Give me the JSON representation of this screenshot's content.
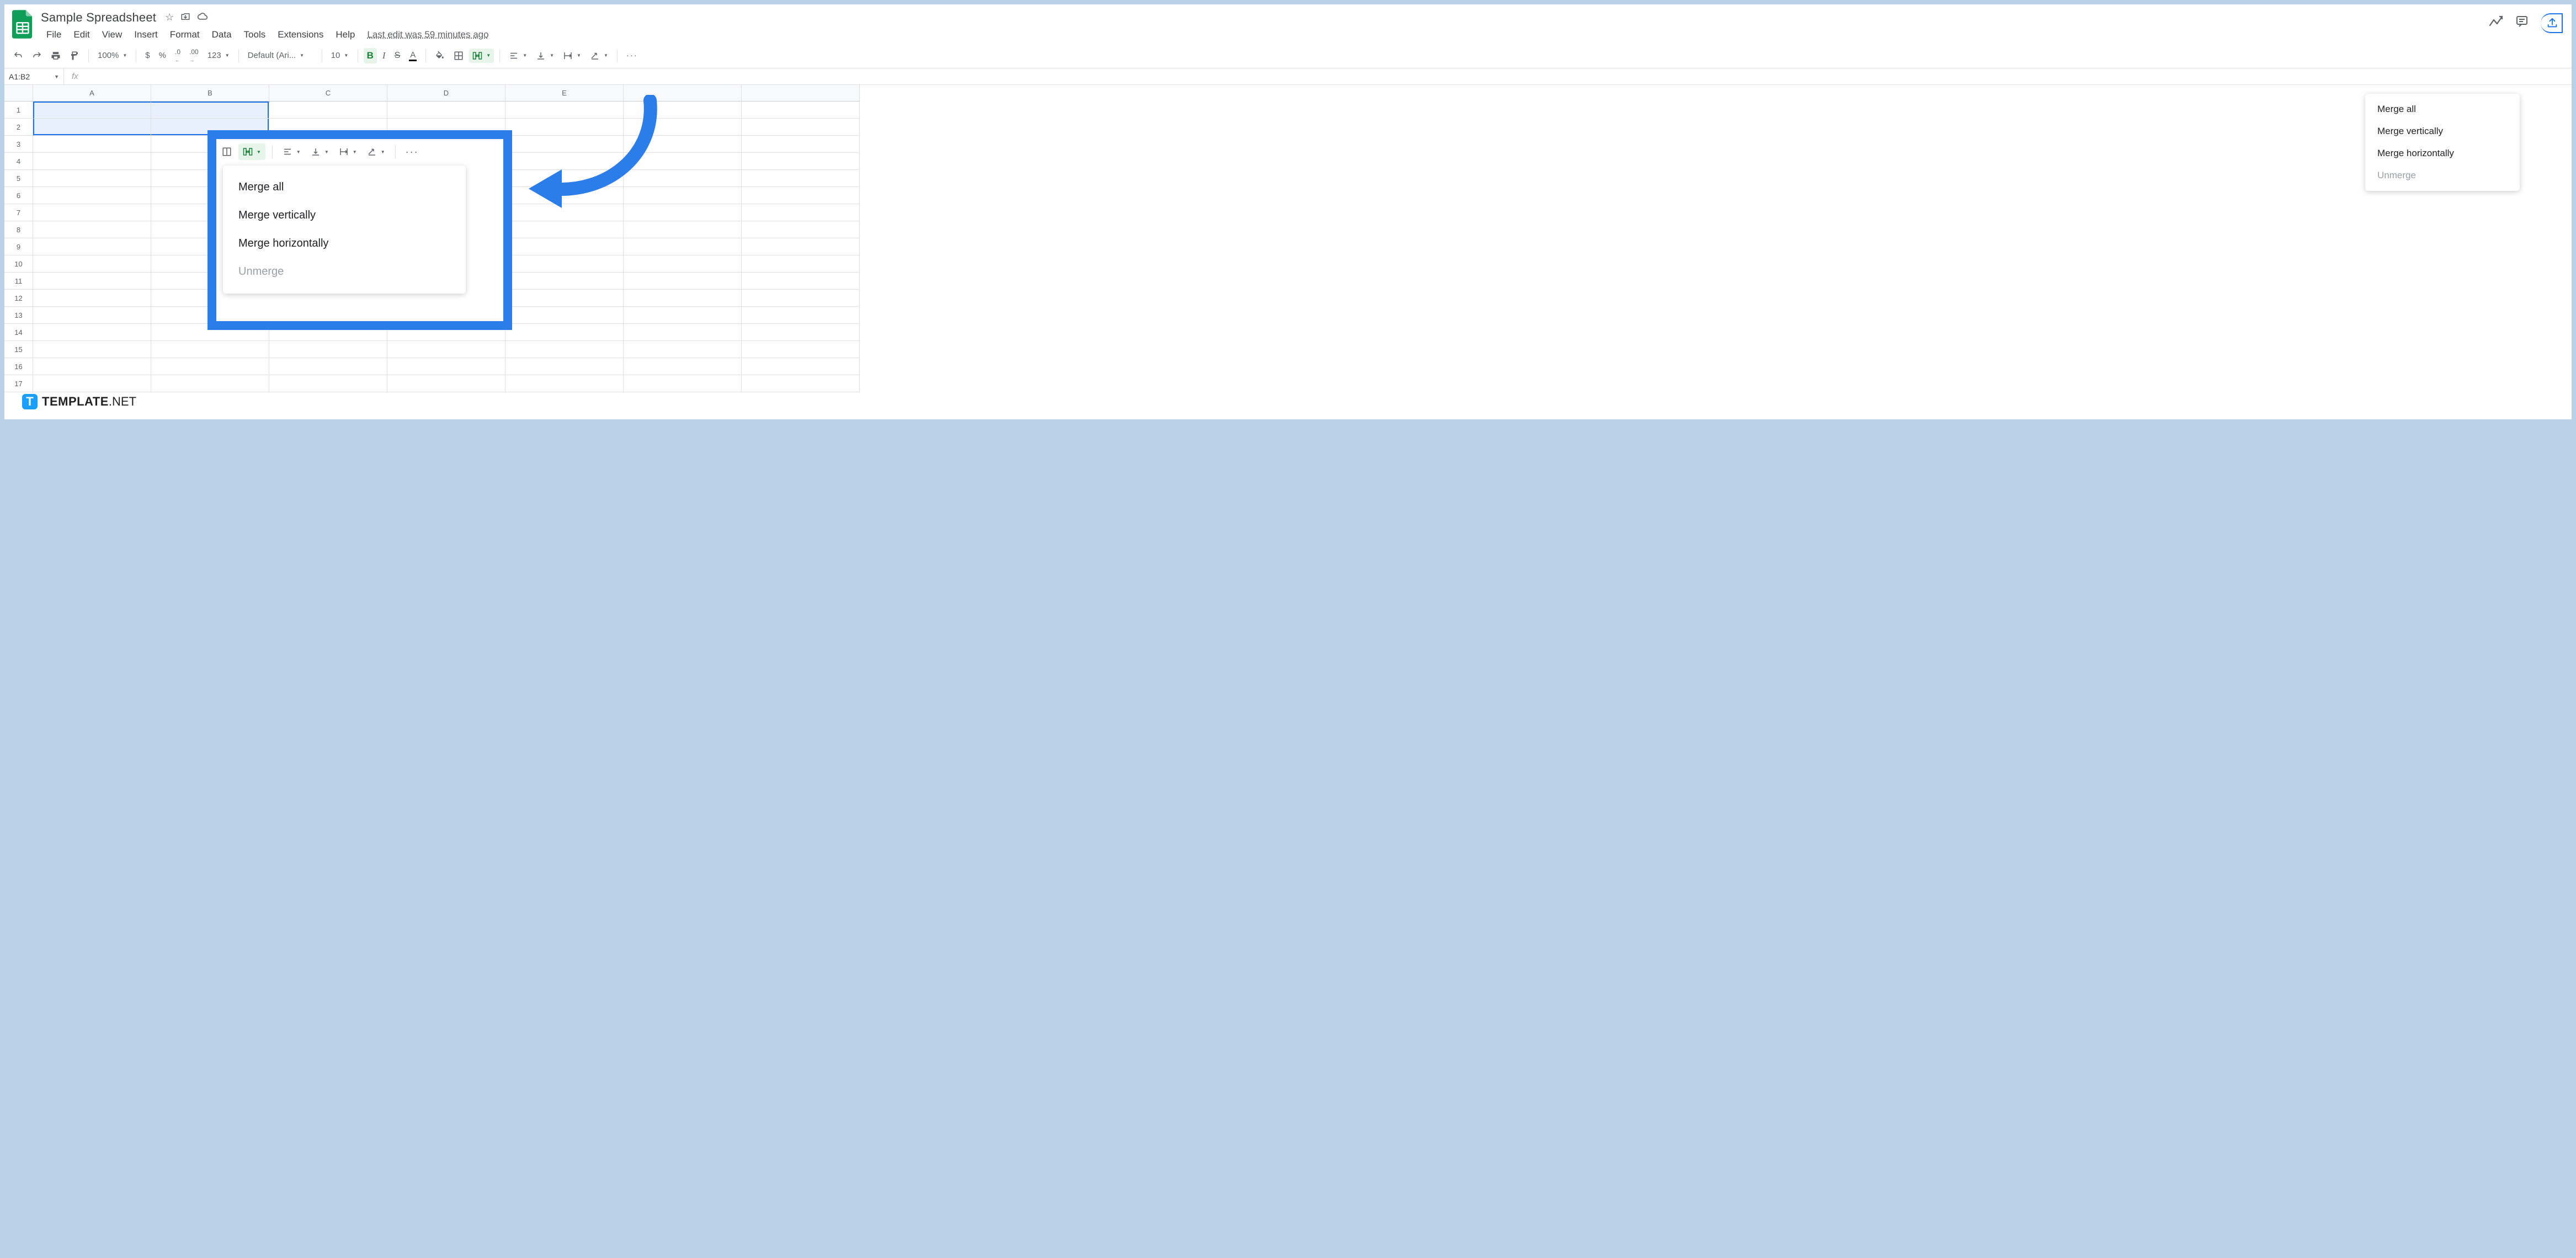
{
  "doc": {
    "title": "Sample Spreadsheet",
    "last_edit": "Last edit was 59 minutes ago"
  },
  "menus": {
    "file": "File",
    "edit": "Edit",
    "view": "View",
    "insert": "Insert",
    "format": "Format",
    "data": "Data",
    "tools": "Tools",
    "extensions": "Extensions",
    "help": "Help"
  },
  "toolbar": {
    "zoom": "100%",
    "currency": "$",
    "percent": "%",
    "dec_dec": ".0",
    "inc_dec": ".00",
    "more_formats": "123",
    "font": "Default (Ari...",
    "font_size": "10",
    "bold": "B",
    "italic": "I",
    "strike": "S",
    "more": "···"
  },
  "namebox": {
    "ref": "A1:B2",
    "fx": "fx"
  },
  "columns": [
    "A",
    "B",
    "C",
    "D",
    "E"
  ],
  "rows": [
    "1",
    "2",
    "3",
    "4",
    "5",
    "6",
    "7",
    "8",
    "9",
    "10",
    "11",
    "12",
    "13",
    "14",
    "15",
    "16",
    "17"
  ],
  "merge_menu": {
    "all": "Merge all",
    "vert": "Merge vertically",
    "horiz": "Merge horizontally",
    "un": "Unmerge"
  },
  "callout_mini": {
    "more": "···"
  },
  "watermark": {
    "pre": "TEMPLATE",
    "post": ".NET",
    "t": "T"
  }
}
